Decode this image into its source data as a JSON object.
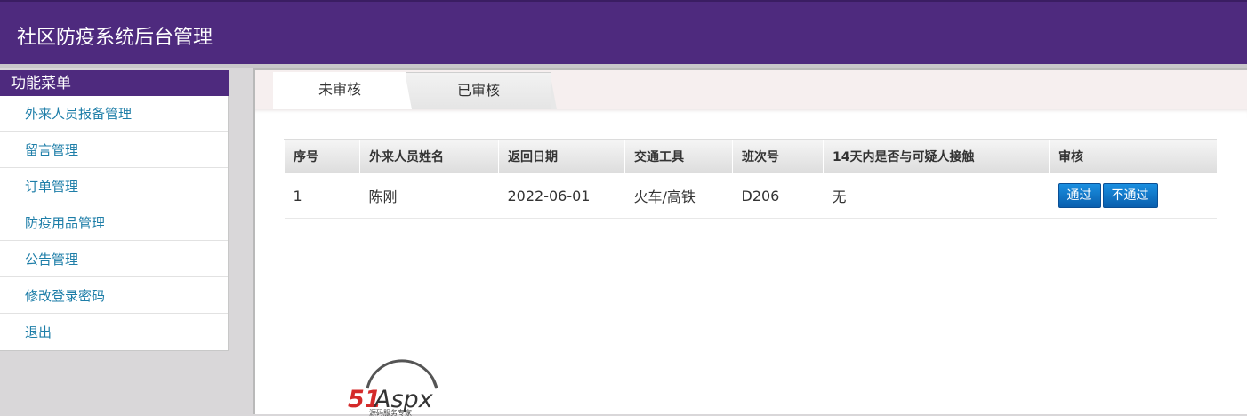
{
  "app": {
    "title": "社区防疫系统后台管理"
  },
  "sidebar": {
    "header": "功能菜单",
    "items": [
      {
        "label": "外来人员报备管理"
      },
      {
        "label": "留言管理"
      },
      {
        "label": "订单管理"
      },
      {
        "label": "防疫用品管理"
      },
      {
        "label": "公告管理"
      },
      {
        "label": "修改登录密码"
      },
      {
        "label": "退出"
      }
    ]
  },
  "tabs": [
    {
      "label": "未审核",
      "active": true
    },
    {
      "label": "已审核",
      "active": false
    }
  ],
  "table": {
    "columns": [
      "序号",
      "外来人员姓名",
      "返回日期",
      "交通工具",
      "班次号",
      "14天内是否与可疑人接触",
      "审核"
    ],
    "rows": [
      {
        "index": "1",
        "name": "陈刚",
        "return_date": "2022-06-01",
        "transport": "火车/高铁",
        "shift": "D206",
        "contact": "无"
      }
    ],
    "actions": {
      "approve": "通过",
      "reject": "不通过"
    }
  },
  "logo": {
    "text": "51Aspx",
    "tagline": "源码服务专家"
  },
  "colors": {
    "header_bg": "#4e2a7e",
    "link": "#1e7ea8",
    "button": "#0a6fc2"
  }
}
